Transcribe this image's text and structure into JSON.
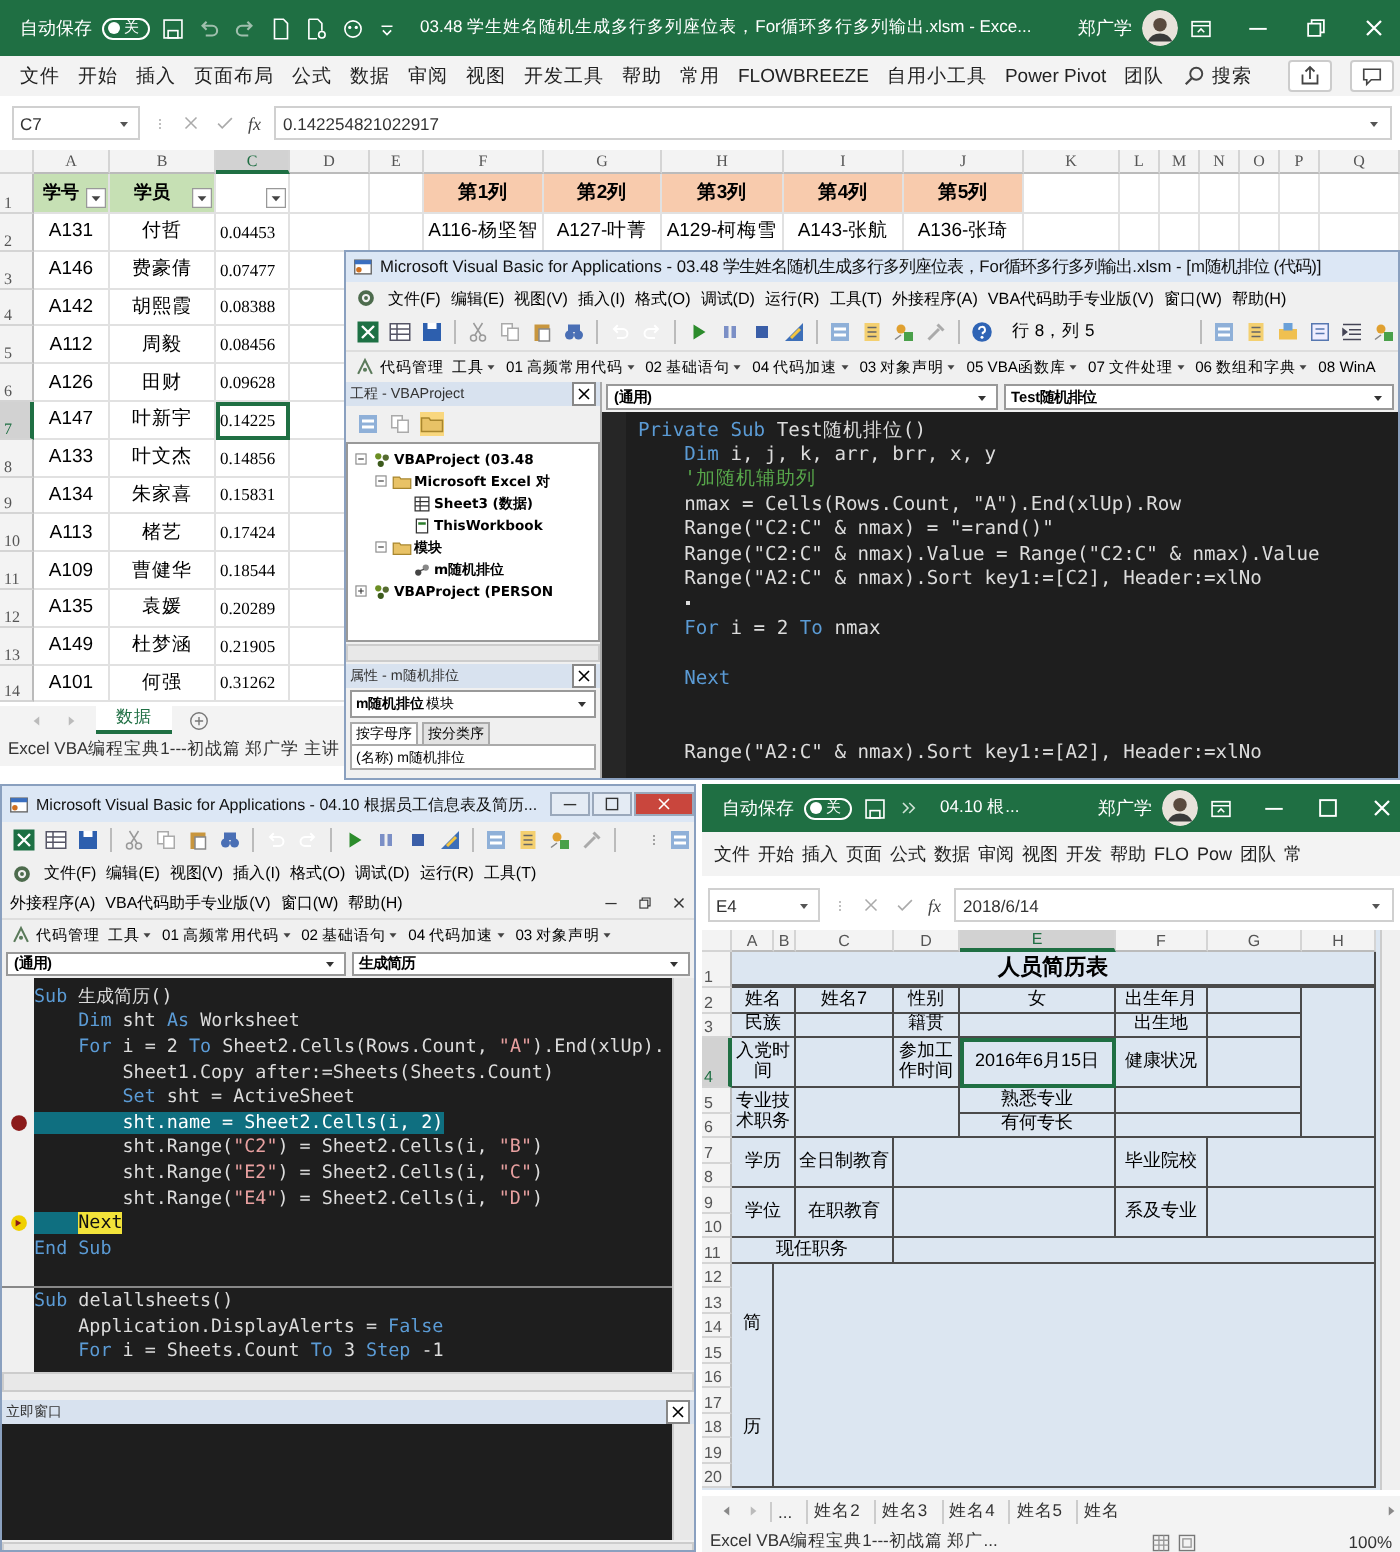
{
  "excel_top": {
    "title_bar": {
      "autosave_label": "自动保存",
      "autosave_on": false,
      "autosave_text": "关",
      "title": "03.48 学生姓名随机生成多行多列座位表，For循环多行多列输出.xlsm - Exce...",
      "user": "郑广学"
    },
    "ribbon_tabs": [
      "文件",
      "开始",
      "插入",
      "页面布局",
      "公式",
      "数据",
      "审阅",
      "视图",
      "开发工具",
      "帮助",
      "常用",
      "FLOWBREEZE",
      "自用小工具",
      "Power Pivot",
      "团队"
    ],
    "search_label": "搜索",
    "formula_bar": {
      "name_box": "C7",
      "fx": "fx",
      "value": "0.142254821022917"
    },
    "columns": [
      "A",
      "B",
      "C",
      "D",
      "E",
      "F",
      "G",
      "H",
      "I",
      "J",
      "K",
      "L",
      "M",
      "N",
      "O",
      "P",
      "Q"
    ],
    "header_row": {
      "number": "1",
      "cells": [
        {
          "text": "学号",
          "kind": "key",
          "filter": true
        },
        {
          "text": "学员",
          "kind": "key",
          "filter": true
        },
        {
          "kind": "plain",
          "filter": true
        },
        null,
        null,
        {
          "text": "第1列",
          "kind": "output",
          "filter": false
        },
        {
          "text": "第2列",
          "kind": "output",
          "filter": false
        },
        {
          "text": "第3列",
          "kind": "output",
          "filter": false
        },
        {
          "text": "第4列",
          "kind": "output",
          "filter": false
        },
        {
          "text": "第5列",
          "kind": "output",
          "filter": false
        }
      ]
    },
    "rows": [
      {
        "number": "2",
        "cells": [
          {
            "text": "A131",
            "selected": false
          },
          {
            "text": "付哲",
            "selected": false
          },
          {
            "text": "0.04453",
            "selected": false
          },
          null,
          null,
          {
            "text": "A116-杨坚智",
            "selected": false
          },
          {
            "text": "A127-叶菁",
            "selected": false
          },
          {
            "text": "A129-柯梅雪",
            "selected": false
          },
          {
            "text": "A143-张航",
            "selected": false
          },
          {
            "text": "A136-张琦",
            "selected": false
          }
        ]
      },
      {
        "number": "3",
        "cells": [
          {
            "text": "A146",
            "selected": false
          },
          {
            "text": "费豪倩",
            "selected": false
          },
          {
            "text": "0.07477",
            "selected": false
          }
        ]
      },
      {
        "number": "4",
        "cells": [
          {
            "text": "A142",
            "selected": false
          },
          {
            "text": "胡熙霞",
            "selected": false
          },
          {
            "text": "0.08388",
            "selected": false
          }
        ]
      },
      {
        "number": "5",
        "cells": [
          {
            "text": "A112",
            "selected": false
          },
          {
            "text": "周毅",
            "selected": false
          },
          {
            "text": "0.08456",
            "selected": false
          }
        ]
      },
      {
        "number": "6",
        "cells": [
          {
            "text": "A126",
            "selected": false
          },
          {
            "text": "田财",
            "selected": false
          },
          {
            "text": "0.09628",
            "selected": false
          }
        ]
      },
      {
        "number": "7",
        "cells": [
          {
            "text": "A147",
            "selected": false
          },
          {
            "text": "叶新宇",
            "selected": false
          },
          {
            "text": "0.14225",
            "selected": true
          }
        ]
      },
      {
        "number": "8",
        "cells": [
          {
            "text": "A133",
            "selected": false
          },
          {
            "text": "叶文杰",
            "selected": false
          },
          {
            "text": "0.14856",
            "selected": false
          }
        ]
      },
      {
        "number": "9",
        "cells": [
          {
            "text": "A134",
            "selected": false
          },
          {
            "text": "朱家喜",
            "selected": false
          },
          {
            "text": "0.15831",
            "selected": false
          }
        ]
      },
      {
        "number": "10",
        "cells": [
          {
            "text": "A113",
            "selected": false
          },
          {
            "text": "楮艺",
            "selected": false
          },
          {
            "text": "0.17424",
            "selected": false
          }
        ]
      },
      {
        "number": "11",
        "cells": [
          {
            "text": "A109",
            "selected": false
          },
          {
            "text": "曹健华",
            "selected": false
          },
          {
            "text": "0.18544",
            "selected": false
          }
        ]
      },
      {
        "number": "12",
        "cells": [
          {
            "text": "A135",
            "selected": false
          },
          {
            "text": "袁媛",
            "selected": false
          },
          {
            "text": "0.20289",
            "selected": false
          }
        ]
      },
      {
        "number": "13",
        "cells": [
          {
            "text": "A149",
            "selected": false
          },
          {
            "text": "杜梦涵",
            "selected": false
          },
          {
            "text": "0.21905",
            "selected": false
          }
        ]
      },
      {
        "number": "14",
        "cells": [
          {
            "text": "A101",
            "selected": false
          },
          {
            "text": "何强",
            "selected": false
          },
          {
            "text": "0.31262",
            "selected": false
          }
        ]
      }
    ],
    "sheet_tabs": [
      {
        "label": "数据",
        "selected": true
      }
    ],
    "status_text": "Excel VBA编程宝典1---初战篇 郑广学 主讲"
  },
  "vba_top": {
    "title": "Microsoft Visual Basic for Applications - 03.48 学生姓名随机生成多行多列座位表，For循环多行多列输出.xlsm - [m随机排位 (代码)]",
    "menu": [
      "文件(F)",
      "编辑(E)",
      "视图(V)",
      "插入(I)",
      "格式(O)",
      "调试(D)",
      "运行(R)",
      "工具(T)",
      "外接程序(A)",
      "VBA代码助手专业版(V)",
      "窗口(W)",
      "帮助(H)"
    ],
    "position": "行 8，列 5",
    "addin_bar": [
      "代码管理",
      "工具",
      "01 高频常用代码",
      "02 基础语句",
      "04 代码加速",
      "03 对象声明",
      "05 VBA函数库",
      "07 文件处理",
      "06 数组和字典",
      "08 WinA"
    ],
    "project_pane": {
      "title": "工程 - VBAProject",
      "tree": [
        {
          "text": "VBAProject (03.48",
          "kind": "project",
          "expanded": true,
          "children": [
            {
              "text": "Microsoft Excel 对",
              "kind": "folder",
              "expanded": true,
              "children": [
                {
                  "text": "Sheet3 (数据)",
                  "kind": "sheet"
                },
                {
                  "text": "ThisWorkbook",
                  "kind": "workbook"
                }
              ]
            },
            {
              "text": "模块",
              "kind": "folder",
              "expanded": true,
              "children": [
                {
                  "text": "m随机排位",
                  "kind": "module"
                }
              ]
            }
          ]
        },
        {
          "text": "VBAProject (PERSON",
          "kind": "project",
          "expanded": false
        }
      ]
    },
    "properties_pane": {
      "title": "属性 - m随机排位",
      "object": "m随机排位",
      "object_type": "模块",
      "tabs": [
        {
          "label": "按字母序",
          "selected": true
        },
        {
          "label": "按分类序",
          "selected": false
        }
      ],
      "rows": [
        {
          "name": "(名称)",
          "value": "m随机排位"
        }
      ]
    },
    "code_pane": {
      "object": "(通用)",
      "procedure": "Test随机排位",
      "lines": [
        {
          "kind": "code",
          "segments": [
            {
              "kind": "keyword",
              "text": "Private Sub"
            },
            {
              "kind": "plain",
              "text": " Test随机排位()"
            }
          ]
        },
        {
          "kind": "code",
          "segments": [
            {
              "kind": "keyword",
              "text": "    Dim"
            },
            {
              "kind": "plain",
              "text": " i, j, k, arr, brr, x, y"
            }
          ]
        },
        {
          "kind": "code",
          "segments": [
            {
              "kind": "comment",
              "text": "    '加随机辅助列"
            }
          ]
        },
        {
          "kind": "code",
          "segments": [
            {
              "kind": "plain",
              "text": "    nmax = Cells(Rows.Count, \"A\").End(xlUp).Row"
            }
          ]
        },
        {
          "kind": "code",
          "segments": [
            {
              "kind": "plain",
              "text": "    Range(\"C2:C\" & nmax) = \"=rand()\""
            }
          ]
        },
        {
          "kind": "code",
          "segments": [
            {
              "kind": "plain",
              "text": "    Range(\"C2:C\" & nmax).Value = Range(\"C2:C\" & nmax).Value"
            }
          ]
        },
        {
          "kind": "code",
          "segments": [
            {
              "kind": "plain",
              "text": "    Range(\"A2:C\" & nmax).Sort key1:=[C2], Header:=xlNo"
            }
          ]
        },
        {
          "kind": "caret"
        },
        {
          "kind": "code",
          "segments": [
            {
              "kind": "keyword",
              "text": "    For"
            },
            {
              "kind": "plain",
              "text": " i = 2 "
            },
            {
              "kind": "keyword",
              "text": "To"
            },
            {
              "kind": "plain",
              "text": " nmax"
            }
          ]
        },
        {
          "kind": "blank"
        },
        {
          "kind": "code",
          "segments": [
            {
              "kind": "keyword",
              "text": "    Next"
            }
          ]
        },
        {
          "kind": "blank"
        },
        {
          "kind": "blank"
        },
        {
          "kind": "code",
          "segments": [
            {
              "kind": "plain",
              "text": "    Range(\"A2:C\" & nmax).Sort key1:=[A2], Header:=xlNo"
            }
          ]
        }
      ]
    }
  },
  "vba_bottom": {
    "title": "Microsoft Visual Basic for Applications - 04.10 根据员工信息表及简历...",
    "menu": [
      "文件(F)",
      "编辑(E)",
      "视图(V)",
      "插入(I)",
      "格式(O)",
      "调试(D)",
      "运行(R)",
      "工具(T)"
    ],
    "menu2": [
      "外接程序(A)",
      "VBA代码助手专业版(V)",
      "窗口(W)",
      "帮助(H)"
    ],
    "addin_bar": [
      "代码管理",
      "工具",
      "01 高频常用代码",
      "02 基础语句",
      "04 代码加速",
      "03 对象声明"
    ],
    "code_pane": {
      "object": "(通用)",
      "procedure": "生成简历",
      "lines": [
        {
          "kind": "code",
          "segments": [
            {
              "kind": "keyword",
              "text": "Sub"
            },
            {
              "kind": "plain",
              "text": " 生成简历()"
            }
          ]
        },
        {
          "kind": "code",
          "segments": [
            {
              "kind": "keyword",
              "text": "    Dim"
            },
            {
              "kind": "plain",
              "text": " sht "
            },
            {
              "kind": "keyword",
              "text": "As"
            },
            {
              "kind": "plain",
              "text": " Worksheet"
            }
          ]
        },
        {
          "kind": "code",
          "segments": [
            {
              "kind": "keyword",
              "text": "    For"
            },
            {
              "kind": "plain",
              "text": " i = 2 "
            },
            {
              "kind": "keyword",
              "text": "To"
            },
            {
              "kind": "plain",
              "text": " Sheet2.Cells(Rows.Count, "
            },
            {
              "kind": "string",
              "text": "\"A\""
            },
            {
              "kind": "plain",
              "text": ").End(xlUp)."
            }
          ]
        },
        {
          "kind": "code",
          "segments": [
            {
              "kind": "plain",
              "text": "        Sheet1.Copy after:=Sheets(Sheets.Count)"
            }
          ]
        },
        {
          "kind": "code",
          "segments": [
            {
              "kind": "keyword",
              "text": "        Set"
            },
            {
              "kind": "plain",
              "text": " sht = ActiveSheet"
            }
          ]
        },
        {
          "kind": "breakpoint",
          "segments": [
            {
              "kind": "plain",
              "text": "        sht.name = Sheet2.Cells(i, 2)"
            }
          ]
        },
        {
          "kind": "code",
          "segments": [
            {
              "kind": "plain",
              "text": "        sht.Range("
            },
            {
              "kind": "string",
              "text": "\"C2\""
            },
            {
              "kind": "plain",
              "text": ") = Sheet2.Cells(i, "
            },
            {
              "kind": "string",
              "text": "\"B\""
            },
            {
              "kind": "plain",
              "text": ")"
            }
          ]
        },
        {
          "kind": "code",
          "segments": [
            {
              "kind": "plain",
              "text": "        sht.Range("
            },
            {
              "kind": "string",
              "text": "\"E2\""
            },
            {
              "kind": "plain",
              "text": ") = Sheet2.Cells(i, "
            },
            {
              "kind": "string",
              "text": "\"C\""
            },
            {
              "kind": "plain",
              "text": ")"
            }
          ]
        },
        {
          "kind": "code",
          "segments": [
            {
              "kind": "plain",
              "text": "        sht.Range("
            },
            {
              "kind": "string",
              "text": "\"E4\""
            },
            {
              "kind": "plain",
              "text": ") = Sheet2.Cells(i, "
            },
            {
              "kind": "string",
              "text": "\"D\""
            },
            {
              "kind": "plain",
              "text": ")"
            }
          ]
        },
        {
          "kind": "current",
          "segments": [
            {
              "kind": "keyword",
              "text": "    Next"
            }
          ]
        },
        {
          "kind": "code",
          "segments": [
            {
              "kind": "keyword",
              "text": "End Sub"
            }
          ]
        },
        {
          "kind": "divider"
        },
        {
          "kind": "code",
          "segments": [
            {
              "kind": "keyword",
              "text": "Sub"
            },
            {
              "kind": "plain",
              "text": " delallsheets()"
            }
          ]
        },
        {
          "kind": "code",
          "segments": [
            {
              "kind": "plain",
              "text": "    Application.DisplayAlerts = "
            },
            {
              "kind": "keyword",
              "text": "False"
            }
          ]
        },
        {
          "kind": "code",
          "segments": [
            {
              "kind": "keyword",
              "text": "    For"
            },
            {
              "kind": "plain",
              "text": " i = Sheets.Count "
            },
            {
              "kind": "keyword",
              "text": "To"
            },
            {
              "kind": "plain",
              "text": " 3 "
            },
            {
              "kind": "keyword",
              "text": "Step"
            },
            {
              "kind": "plain",
              "text": " -1"
            }
          ]
        }
      ]
    },
    "immediate_title": "立即窗口"
  },
  "excel_bottom": {
    "title_bar": {
      "autosave_label": "自动保存",
      "autosave_on": false,
      "autosave_text": "关",
      "title": "04.10 根...",
      "user": "郑广学"
    },
    "ribbon_tabs": [
      "文件",
      "开始",
      "插入",
      "页面",
      "公式",
      "数据",
      "审阅",
      "视图",
      "开发",
      "帮助",
      "FLO",
      "Pow",
      "团队",
      "常"
    ],
    "formula_bar": {
      "name_box": "E4",
      "fx": "fx",
      "value": "2018/6/14"
    },
    "columns": [
      "A",
      "B",
      "C",
      "D",
      "E",
      "F",
      "G",
      "H"
    ],
    "rows": [
      {
        "number": "1",
        "cells": [
          {
            "text": "人员简历表",
            "colspan": 8,
            "selected": false
          }
        ]
      },
      {
        "number": "2",
        "cells": [
          {
            "text": "姓名",
            "colspan": 2,
            "selected": false
          },
          {
            "text": "姓名7",
            "selected": false
          },
          {
            "text": "性别",
            "selected": false
          },
          {
            "text": "女",
            "selected": false
          },
          {
            "text": "出生年月",
            "selected": false
          },
          {
            "selected": false
          },
          {
            "rowspan": 5,
            "selected": false
          }
        ]
      },
      {
        "number": "3",
        "cells": [
          {
            "text": "民族",
            "colspan": 2,
            "selected": false
          },
          {
            "selected": false
          },
          {
            "text": "籍贯",
            "selected": false
          },
          {
            "selected": false
          },
          {
            "text": "出生地",
            "selected": false
          },
          {
            "selected": false
          }
        ]
      },
      {
        "number": "4",
        "cells": [
          {
            "text": "入党时间",
            "colspan": 2,
            "selected": false
          },
          {
            "selected": false
          },
          {
            "text": "参加工作时间",
            "selected": false
          },
          {
            "text": "2016年6月15日",
            "selected": true
          },
          {
            "text": "健康状况",
            "selected": false
          },
          {
            "selected": false
          }
        ]
      },
      {
        "number": "5",
        "cells": [
          {
            "text": "专业技术职务",
            "colspan": 2,
            "rowspan": 2,
            "selected": false
          },
          {
            "colspan": 2,
            "rowspan": 2,
            "selected": false
          },
          {
            "text": "熟悉专业",
            "selected": false
          },
          {
            "colspan": 2,
            "selected": false
          }
        ]
      },
      {
        "number": "6",
        "cells": [
          {
            "text": "有何专长",
            "selected": false
          },
          {
            "colspan": 2,
            "selected": false
          }
        ]
      },
      {
        "number": "7",
        "cells": [
          {
            "text": "学历",
            "colspan": 2,
            "rowspan": 2,
            "selected": false
          },
          {
            "text": "全日制教育",
            "rowspan": 2,
            "selected": false
          },
          {
            "colspan": 2,
            "rowspan": 2,
            "selected": false
          },
          {
            "text": "毕业院校",
            "rowspan": 2,
            "selected": false
          },
          {
            "colspan": 2,
            "rowspan": 2,
            "selected": false
          }
        ]
      },
      {
        "number": "8"
      },
      {
        "number": "9",
        "cells": [
          {
            "text": "学位",
            "colspan": 2,
            "rowspan": 2,
            "selected": false
          },
          {
            "text": "在职教育",
            "rowspan": 2,
            "selected": false
          },
          {
            "colspan": 2,
            "rowspan": 2,
            "selected": false
          },
          {
            "text": "系及专业",
            "rowspan": 2,
            "selected": false
          },
          {
            "colspan": 2,
            "rowspan": 2,
            "selected": false
          }
        ]
      },
      {
        "number": "10"
      },
      {
        "number": "11",
        "cells": [
          {
            "text": "现任职务",
            "colspan": 3,
            "selected": false
          },
          {
            "colspan": 5,
            "selected": false
          }
        ]
      },
      {
        "number": "12",
        "cells": [
          {
            "text": "简历",
            "kind": "vertical",
            "rowspan": 9,
            "selected": false
          },
          {
            "colspan": 7,
            "rowspan": 9,
            "selected": false
          }
        ]
      },
      {
        "number": "13"
      },
      {
        "number": "14"
      },
      {
        "number": "15"
      },
      {
        "number": "16"
      },
      {
        "number": "17"
      },
      {
        "number": "18"
      },
      {
        "number": "19"
      },
      {
        "number": "20"
      }
    ],
    "sheet_tabs": [
      "...",
      "姓名2",
      "姓名3",
      "姓名4",
      "姓名5",
      "姓名"
    ],
    "status_text": "Excel VBA编程宝典1---初战篇 郑广...",
    "zoom": "100%"
  }
}
